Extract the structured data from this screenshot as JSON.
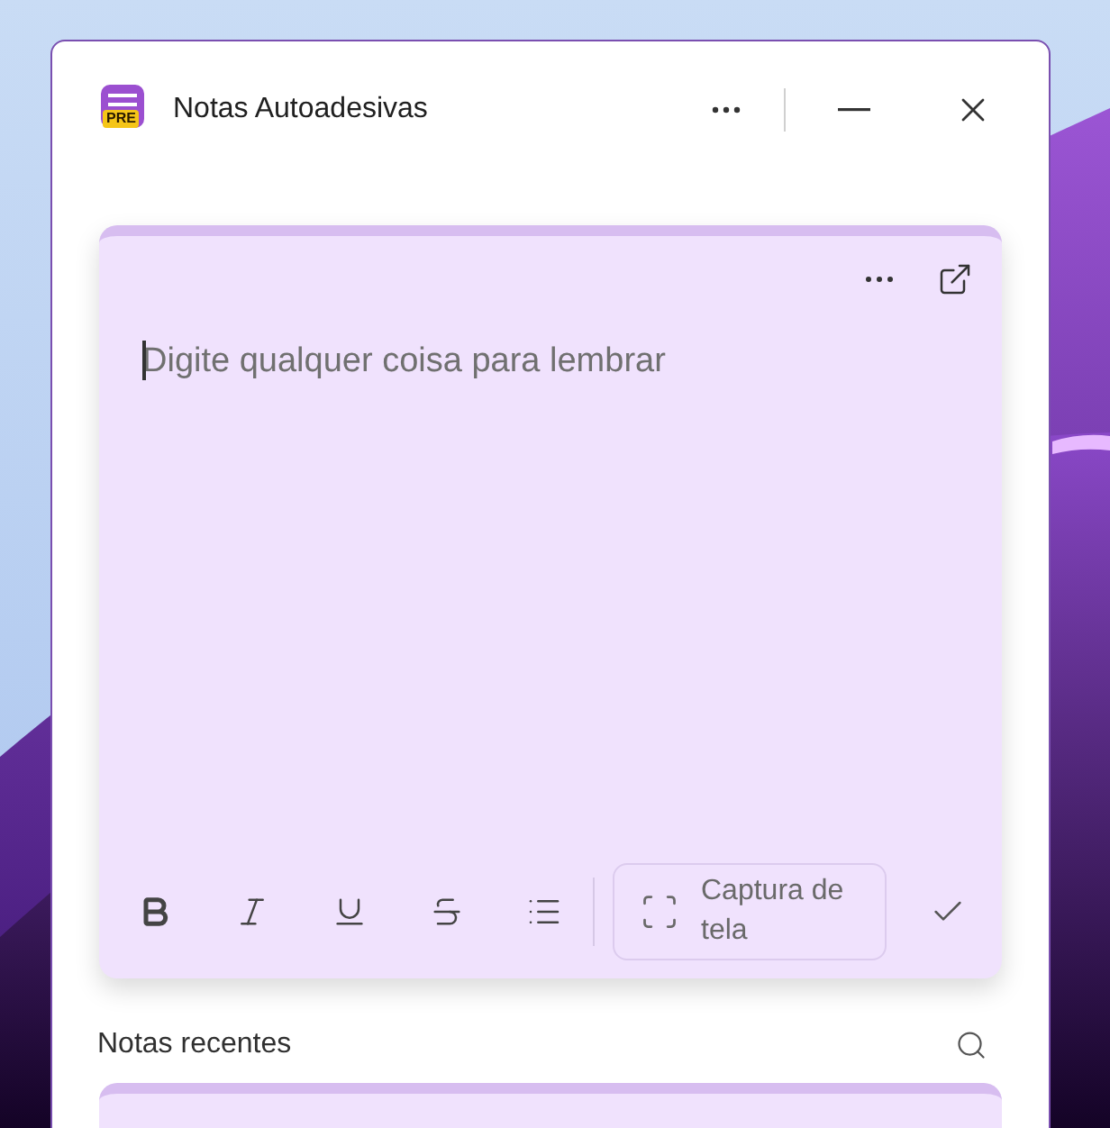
{
  "window": {
    "title": "Notas Autoadesivas",
    "app_badge": "PRE"
  },
  "editor": {
    "placeholder": "Digite qualquer coisa para lembrar",
    "toolbar": [
      {
        "kind": "bold"
      },
      {
        "kind": "italic"
      },
      {
        "kind": "underline"
      },
      {
        "kind": "strike"
      },
      {
        "kind": "list"
      }
    ],
    "screenshot_button": "Captura de tela"
  },
  "recent": {
    "heading": "Notas recentes"
  }
}
